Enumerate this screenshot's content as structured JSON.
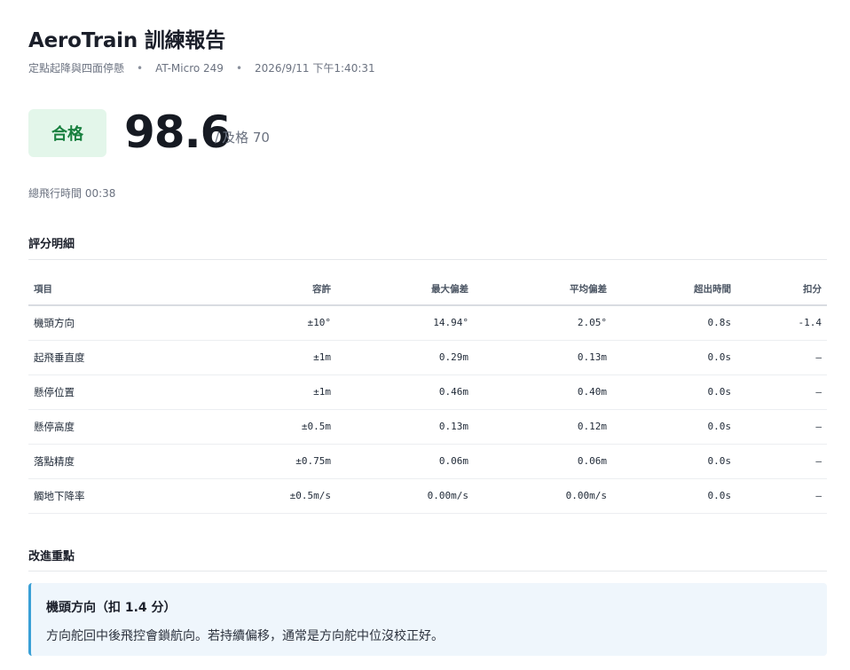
{
  "report": {
    "title": "AeroTrain 訓練報告",
    "mission": "定點起降與四面停懸",
    "separator": "•",
    "aircraft": "AT-Micro 249",
    "datetime": "2026/9/11 下午1:40:31"
  },
  "result": {
    "status": "合格",
    "score": "98.6",
    "pass_separator": "/",
    "pass_label": "及格 70",
    "status_color": "#18803f",
    "status_bg": "#e3f6ea"
  },
  "flight_time": "總飛行時間 00:38",
  "breakdown": {
    "title": "評分明細",
    "columns": [
      "項目",
      "容許",
      "最大偏差",
      "平均偏差",
      "超出時間",
      "扣分"
    ],
    "rows": [
      [
        "機頭方向",
        "±10°",
        "14.94°",
        "2.05°",
        "0.8s",
        "-1.4"
      ],
      [
        "起飛垂直度",
        "±1m",
        "0.29m",
        "0.13m",
        "0.0s",
        "—"
      ],
      [
        "懸停位置",
        "±1m",
        "0.46m",
        "0.40m",
        "0.0s",
        "—"
      ],
      [
        "懸停高度",
        "±0.5m",
        "0.13m",
        "0.12m",
        "0.0s",
        "—"
      ],
      [
        "落點精度",
        "±0.75m",
        "0.06m",
        "0.06m",
        "0.0s",
        "—"
      ],
      [
        "觸地下降率",
        "±0.5m/s",
        "0.00m/s",
        "0.00m/s",
        "0.0s",
        "—"
      ]
    ]
  },
  "improvements": {
    "title": "改進重點",
    "items": [
      {
        "heading": "機頭方向（扣 1.4 分）",
        "body": "方向舵回中後飛控會鎖航向。若持續偏移，通常是方向舵中位沒校正好。"
      }
    ]
  }
}
